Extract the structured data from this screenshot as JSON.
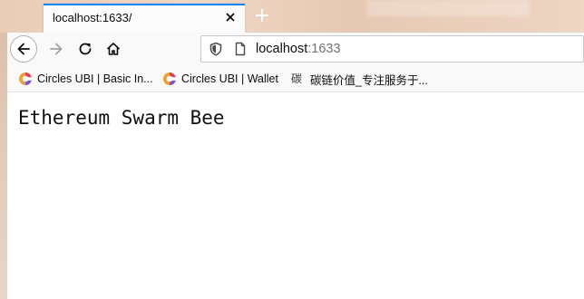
{
  "tab": {
    "title": "localhost:1633/",
    "close_icon": "close-icon",
    "new_tab_icon": "plus-icon"
  },
  "navigation": {
    "back_icon": "arrow-left-icon",
    "forward_icon": "arrow-right-icon",
    "reload_icon": "reload-icon",
    "home_icon": "home-icon"
  },
  "urlbar": {
    "host": "localhost",
    "port": ":1633",
    "shield_icon": "shield-icon",
    "page_icon": "page-icon"
  },
  "bookmarks": [
    {
      "label": "Circles UBI | Basic In...",
      "icon": "circles-logo-icon"
    },
    {
      "label": "Circles UBI | Wallet",
      "icon": "circles-logo-icon"
    },
    {
      "label": "碳链价值_专注服务于...",
      "icon": "tan-char-icon",
      "icon_glyph": "碳"
    }
  ],
  "page": {
    "heading": "Ethereum Swarm Bee"
  },
  "colors": {
    "tab_accent": "#0a84ff",
    "toolbar_bg": "#f9f9fa",
    "page_bg": "#ffffff"
  }
}
